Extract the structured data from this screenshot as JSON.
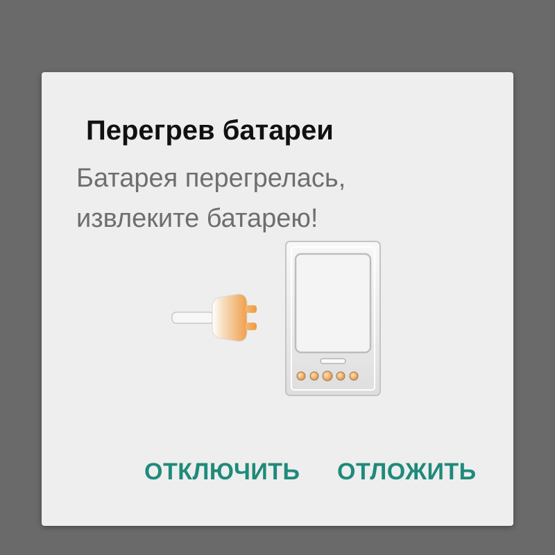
{
  "dialog": {
    "title": "Перегрев батареи",
    "message_line1": "Батарея перегрелась,",
    "message_line2": "извлеките батарею!",
    "illustration_icon": "charger-plug-and-phone-icon",
    "buttons": {
      "disable_label": "ОТКЛЮЧИТЬ",
      "postpone_label": "ОТЛОЖИТЬ"
    }
  },
  "colors": {
    "backdrop": "#6a6a6a",
    "dialog_bg": "#eeeeee",
    "title": "#111111",
    "message": "#6e6e6e",
    "accent": "#1f8a7a",
    "plug_orange": "#f0a04b"
  }
}
